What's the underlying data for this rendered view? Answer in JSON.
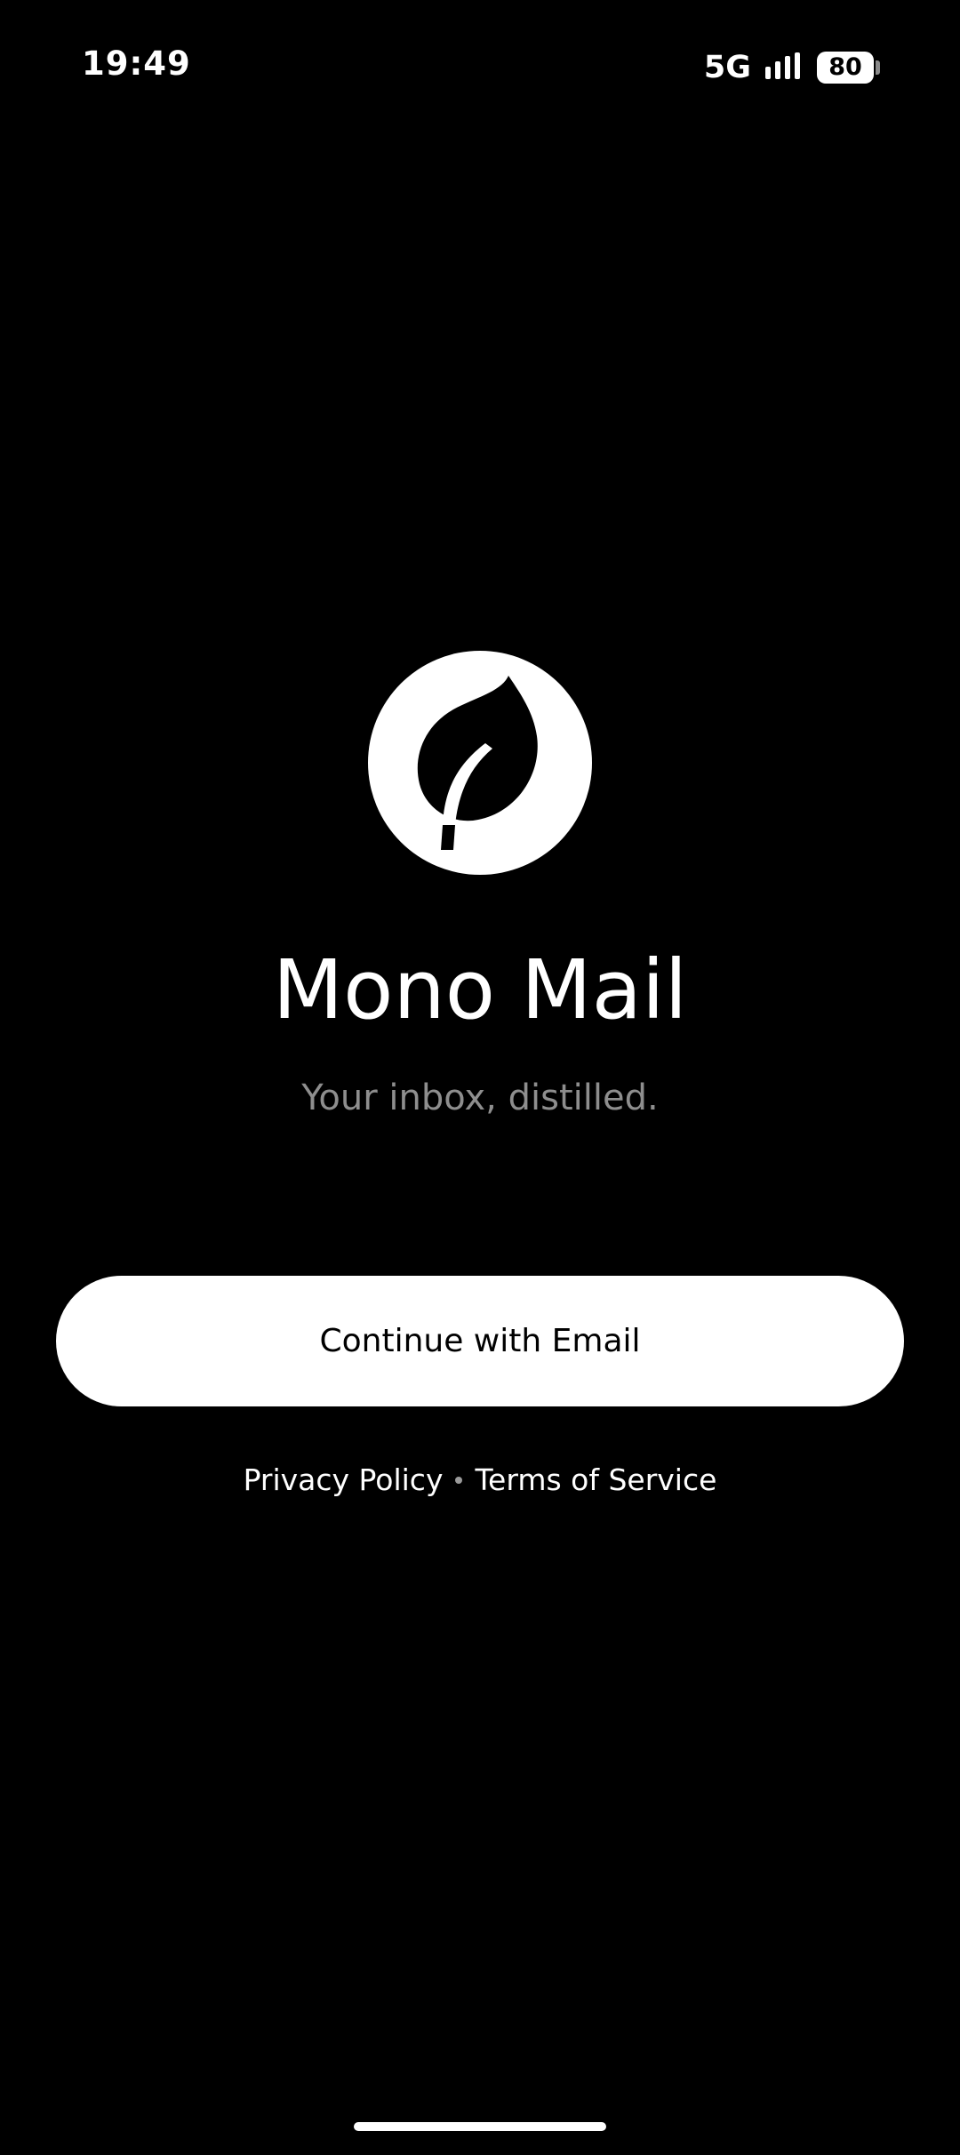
{
  "status_bar": {
    "time": "19:49",
    "network": "5G",
    "battery_level": "80",
    "icons": [
      "signal-bars-icon",
      "battery-icon"
    ]
  },
  "app": {
    "logo_icon": "leaf-icon",
    "name": "Mono Mail",
    "tagline": "Your inbox, distilled."
  },
  "actions": {
    "continue_label": "Continue with Email"
  },
  "legal": {
    "privacy_label": "Privacy Policy",
    "terms_label": "Terms of Service"
  },
  "colors": {
    "background": "#000000",
    "foreground": "#ffffff",
    "tagline": "#8e8e8e"
  }
}
